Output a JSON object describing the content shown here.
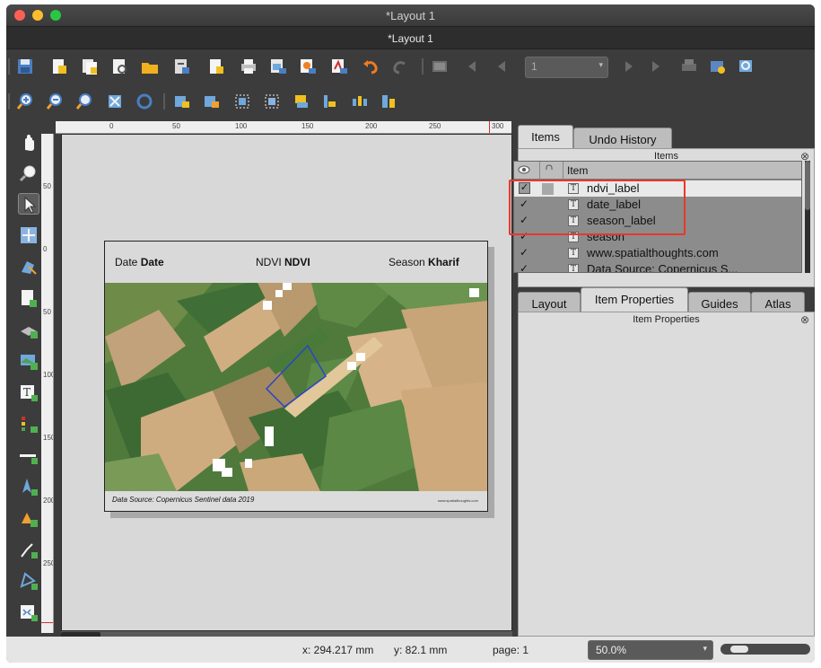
{
  "window": {
    "title": "*Layout 1",
    "subtitle": "*Layout 1"
  },
  "toolbar": {
    "page_combo_value": "1"
  },
  "ruler": {
    "h_labels": [
      "0",
      "50",
      "100",
      "150",
      "200",
      "250",
      "300"
    ],
    "v_labels": [
      "50",
      "0",
      "50",
      "100",
      "150",
      "200",
      "250"
    ]
  },
  "layout": {
    "header": {
      "date_label": "Date",
      "date_value": "Date",
      "ndvi_label": "NDVI",
      "ndvi_value": "NDVI",
      "season_label": "Season",
      "season_value": "Kharif"
    },
    "footer": {
      "source": "Data Source: Copernicus Sentinel data 2019",
      "website": "www.spatialthoughts.com"
    }
  },
  "statusbar": {
    "x": "x: 294.217 mm",
    "y": "y: 82.1 mm",
    "page": "page: 1",
    "zoom": "50.0%",
    "zoom_level": 0.1
  },
  "panel": {
    "tabs_top": [
      "Items",
      "Undo History"
    ],
    "items_title": "Items",
    "items_column": "Item",
    "items": [
      {
        "label": "ndvi_label",
        "checked": "✓",
        "selected": true
      },
      {
        "label": "date_label",
        "checked": "✓",
        "selected": false
      },
      {
        "label": "season_label",
        "checked": "✓",
        "selected": false
      },
      {
        "label": "season",
        "checked": "✓",
        "selected": false
      },
      {
        "label": "www.spatialthoughts.com",
        "checked": "✓",
        "selected": false
      },
      {
        "label": "Data Source: Copernicus S...",
        "checked": "✓",
        "selected": false
      }
    ],
    "tabs_bottom": [
      "Layout",
      "Item Properties",
      "Guides",
      "Atlas"
    ],
    "props_title": "Item Properties"
  },
  "colors": {
    "highlight": "#e8382b",
    "accent": "#f0a030"
  }
}
